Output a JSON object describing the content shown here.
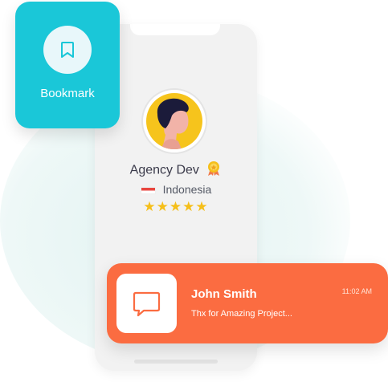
{
  "profile": {
    "name": "Agency Dev",
    "country": "Indonesia",
    "rating_stars": "★★★★★",
    "rating": 5
  },
  "bookmark": {
    "label": "Bookmark"
  },
  "notification": {
    "sender": "John Smith",
    "message": "Thx for Amazing Project...",
    "time": "11:02 AM"
  },
  "colors": {
    "bookmark_bg": "#1ac7d8",
    "notification_bg": "#fb6c41",
    "avatar_bg": "#f6c41c",
    "star": "#f5bf1a"
  },
  "icons": {
    "bookmark": "bookmark-icon",
    "chat": "chat-bubble-icon",
    "medal": "medal-icon",
    "flag": "indonesia-flag-icon"
  }
}
